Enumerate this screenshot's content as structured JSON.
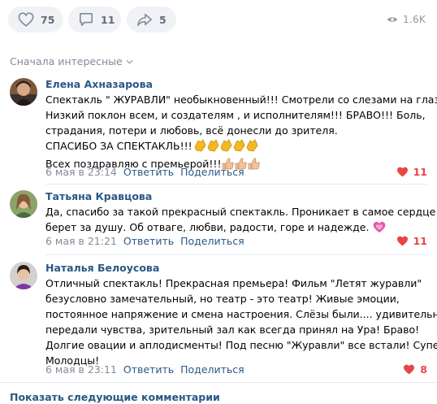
{
  "actions": {
    "likes_count": "75",
    "comments_count": "11",
    "shares_count": "5",
    "views_count": "1.6K"
  },
  "sort_label": "Сначала интересные",
  "comments": [
    {
      "author": "Елена Ахназарова",
      "lines": [
        "Спектакль \" ЖУРАВЛИ\" необыкновенный!!! Смотрели со слезами на глазах.",
        "Низкий поклон всем, и создателям , и исполнителям!!! БРАВО!!! Боль,",
        "страдания, потери и любовь, всё донесли до зрителя.",
        "СПАСИБО ЗА СПЕКТАКЛЬ!!!",
        "Всех поздравляю с премьерой!!!"
      ],
      "emoji_line4": "clapping-hands x5",
      "emoji_line5": "thumbs-up x3",
      "date": "6 мая в 23:14",
      "reply_label": "Ответить",
      "share_label": "Поделиться",
      "likes": "11"
    },
    {
      "author": "Татьяна Кравцова",
      "lines": [
        "Да, спасибо за такой прекрасный спектакль. Проникает в самое сердце и",
        "берет за душу. Об отваге, любви, радости, горе и надежде."
      ],
      "emoji_line2": "sparkling-heart",
      "date": "6 мая в 21:21",
      "reply_label": "Ответить",
      "share_label": "Поделиться",
      "likes": "11"
    },
    {
      "author": "Наталья Белоусова",
      "lines": [
        "Отличный спектакль! Прекрасная премьера! Фильм \"Летят журавли\"",
        "безусловно замечательный, но театр - это театр! Живые эмоции,",
        "постоянное напряжение и смена настроения. Слёзы были.... удивительно",
        "передали чувства, зрительный зал как всегда принял на Ура! Браво!",
        "Долгие овации и аплодисменты! Под песню \"Журавли\" все встали! Супер!",
        "Молодцы!"
      ],
      "date": "6 мая в 23:11",
      "reply_label": "Ответить",
      "share_label": "Поделиться",
      "likes": "8"
    }
  ],
  "show_more_label": "Показать следующие комментарии",
  "colors": {
    "link": "#2a5885",
    "muted": "#818c99",
    "like_red": "#e64646",
    "pill_bg": "#f0f2f5"
  }
}
